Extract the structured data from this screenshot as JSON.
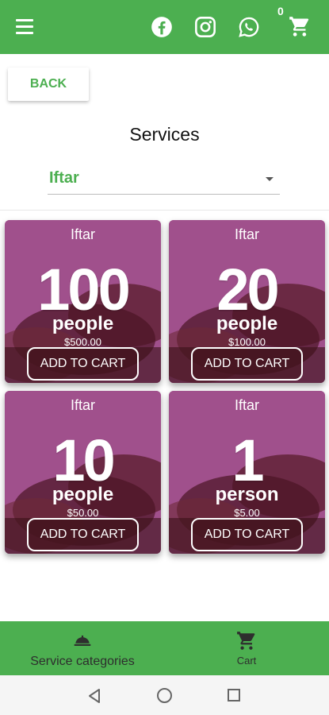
{
  "header": {
    "cart_count": "0",
    "icons": [
      "menu-icon",
      "facebook-icon",
      "instagram-icon",
      "whatsapp-icon",
      "cart-icon"
    ],
    "brand_color": "#4caf50"
  },
  "back_label": "BACK",
  "page_title": "Services",
  "category_select": {
    "value": "Iftar"
  },
  "cards": [
    {
      "label": "Iftar",
      "number": "100",
      "unit": "people",
      "price": "$500.00",
      "button": "ADD TO CART"
    },
    {
      "label": "Iftar",
      "number": "20",
      "unit": "people",
      "price": "$100.00",
      "button": "ADD TO CART"
    },
    {
      "label": "Iftar",
      "number": "10",
      "unit": "people",
      "price": "$50.00",
      "button": "ADD TO CART"
    },
    {
      "label": "Iftar",
      "number": "1",
      "unit": "person",
      "price": "$5.00",
      "button": "ADD TO CART"
    }
  ],
  "bottom_nav": {
    "items": [
      {
        "label": "Service categories",
        "icon": "service-bell-icon"
      },
      {
        "label": "Cart",
        "icon": "cart-icon"
      }
    ]
  },
  "card_color": "#a0508c"
}
